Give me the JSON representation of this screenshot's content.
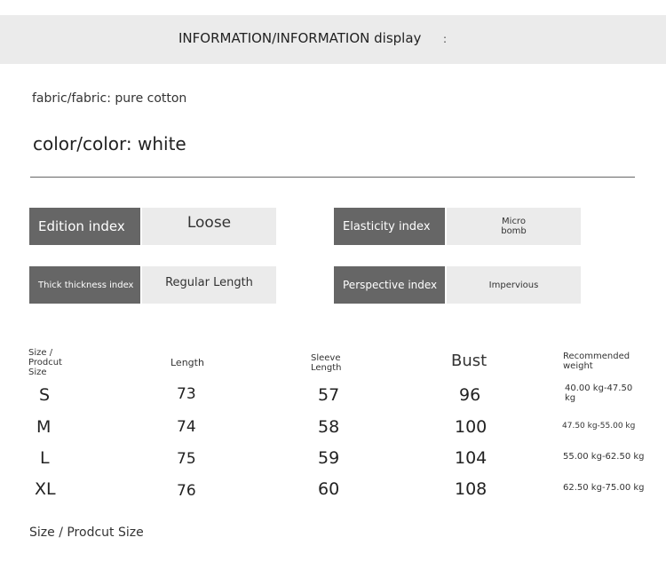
{
  "header": {
    "title": "INFORMATION/INFORMATION display",
    "mark": ":"
  },
  "product": {
    "fabric": "fabric/fabric: pure cotton",
    "color": "color/color: white"
  },
  "indices": {
    "edition": {
      "label": "Edition index",
      "value": "Loose"
    },
    "elasticity": {
      "label": "Elasticity index",
      "value_line1": "Micro",
      "value_line2": "bomb"
    },
    "thickness": {
      "label": "Thick thickness index",
      "value": "Regular Length"
    },
    "perspective": {
      "label": "Perspective index",
      "value": "Impervious"
    }
  },
  "size_table": {
    "headers": {
      "size_line1": "Size /",
      "size_line2": "Prodcut",
      "size_line3": "Size",
      "length": "Length",
      "sleeve_line1": "Sleeve",
      "sleeve_line2": "Length",
      "bust": "Bust",
      "weight_line1": "Recommended",
      "weight_line2": "weight"
    },
    "rows": [
      {
        "size": "S",
        "length": "73",
        "sleeve": "57",
        "bust": "96",
        "weight_line1": "40.00 kg-47.50",
        "weight_line2": "kg"
      },
      {
        "size": "M",
        "length": "74",
        "sleeve": "58",
        "bust": "100",
        "weight": "47.50 kg-55.00 kg"
      },
      {
        "size": "L",
        "length": "75",
        "sleeve": "59",
        "bust": "104",
        "weight": "55.00 kg-62.50 kg"
      },
      {
        "size": "XL",
        "length": "76",
        "sleeve": "60",
        "bust": "108",
        "weight": "62.50 kg-75.00 kg"
      }
    ]
  },
  "footer": {
    "note": "Size / Prodcut Size"
  }
}
